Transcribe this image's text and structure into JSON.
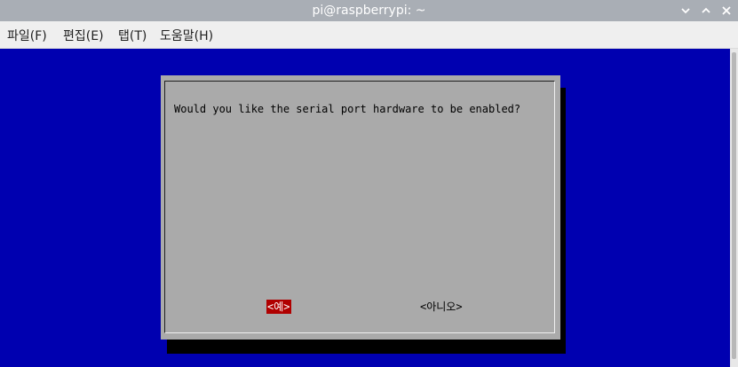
{
  "window": {
    "title": "pi@raspberrypi: ~",
    "controls": [
      "chevron-down-icon",
      "chevron-up-icon",
      "close-icon"
    ]
  },
  "menubar": {
    "items": [
      "파일(F)",
      "편집(E)",
      "탭(T)",
      "도움말(H)"
    ]
  },
  "dialog": {
    "question": "Would you like the serial port hardware to be enabled?",
    "yes_label": "<예>",
    "no_label": "<아니오>"
  },
  "colors": {
    "terminal_bg": "#0000b0",
    "dialog_bg": "#aaaaaa",
    "selected_button_bg": "#b00000"
  }
}
